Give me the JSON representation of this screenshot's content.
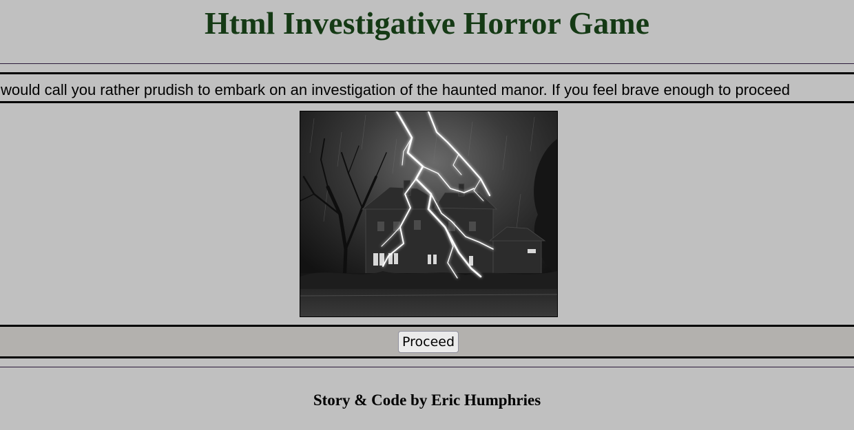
{
  "header": {
    "title": "Html Investigative Horror Game"
  },
  "intro": {
    "marquee_text": "would call you rather prudish to embark on an investigation of the haunted manor. If you feel brave enough to proceed"
  },
  "scene": {
    "image_subject": "haunted manor in a thunderstorm with lightning"
  },
  "actions": {
    "proceed_label": "Proceed"
  },
  "footer": {
    "credits": "Story & Code by Eric Humphries"
  },
  "colors": {
    "page_background": "#c0c0c0",
    "title_color": "#153a15",
    "action_band": "#b3b1ae"
  }
}
